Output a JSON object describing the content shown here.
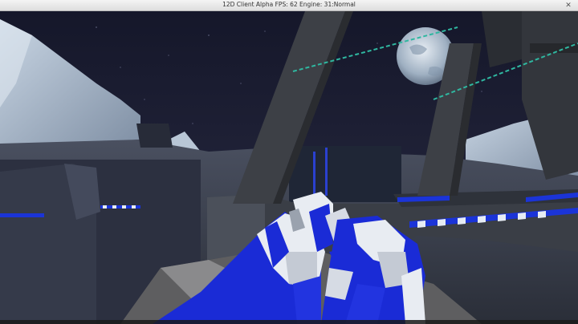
{
  "window": {
    "title": "12D Client Alpha FPS: 62 Engine: 31:Normal",
    "close_icon": "close-icon"
  },
  "scene": {
    "type": "first-person shooter view",
    "colors": {
      "sky": "#1a1c2e",
      "moon": "#b9c8d8",
      "terrain": "#8a98a8",
      "structure": "#3c3f44",
      "weapon_blue": "#1a2bd6",
      "weapon_white": "#e8ecf2",
      "accent_cyan": "#2fb7a0"
    }
  }
}
